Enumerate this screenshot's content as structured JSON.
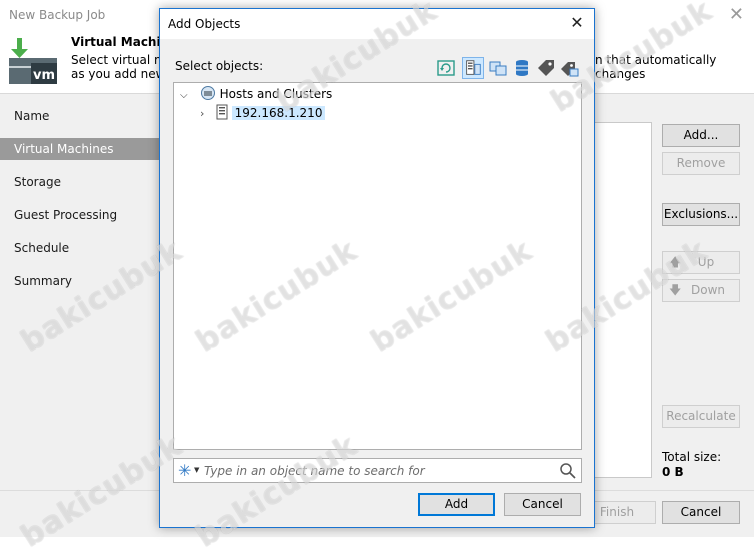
{
  "background_window": {
    "title": "New Backup Job",
    "header_title": "Virtual Machines",
    "header_desc_line1": "Select virtual ma",
    "header_desc_line1_right": "n that automatically changes",
    "header_desc_line2": "as you add new V",
    "nav_items": [
      {
        "label": "Name"
      },
      {
        "label": "Virtual Machines"
      },
      {
        "label": "Storage"
      },
      {
        "label": "Guest Processing"
      },
      {
        "label": "Schedule"
      },
      {
        "label": "Summary"
      }
    ],
    "buttons": {
      "add": "Add...",
      "remove": "Remove",
      "exclusions": "Exclusions...",
      "up": "Up",
      "down": "Down",
      "recalculate": "Recalculate",
      "finish": "Finish",
      "cancel": "Cancel"
    },
    "total_size_label": "Total size:",
    "total_size_value": "0 B"
  },
  "dialog": {
    "title": "Add Objects",
    "select_label": "Select objects:",
    "toolbar_icons": [
      "refresh-icon",
      "hosts-and-clusters-view-icon",
      "vms-and-templates-view-icon",
      "datastores-view-icon",
      "tags-view-icon",
      "vm-tags-view-icon"
    ],
    "tree": {
      "root": "Hosts and Clusters",
      "child": "192.168.1.210"
    },
    "search": {
      "placeholder": "Type in an object name to search for",
      "value": ""
    },
    "add_button": "Add",
    "cancel_button": "Cancel"
  },
  "watermark": "bakicubuk",
  "colors": {
    "accent_blue": "#0078d7",
    "selection": "#cce8ff",
    "nav_active": "#9a9a9a",
    "veeam_green": "#4cae4c"
  }
}
